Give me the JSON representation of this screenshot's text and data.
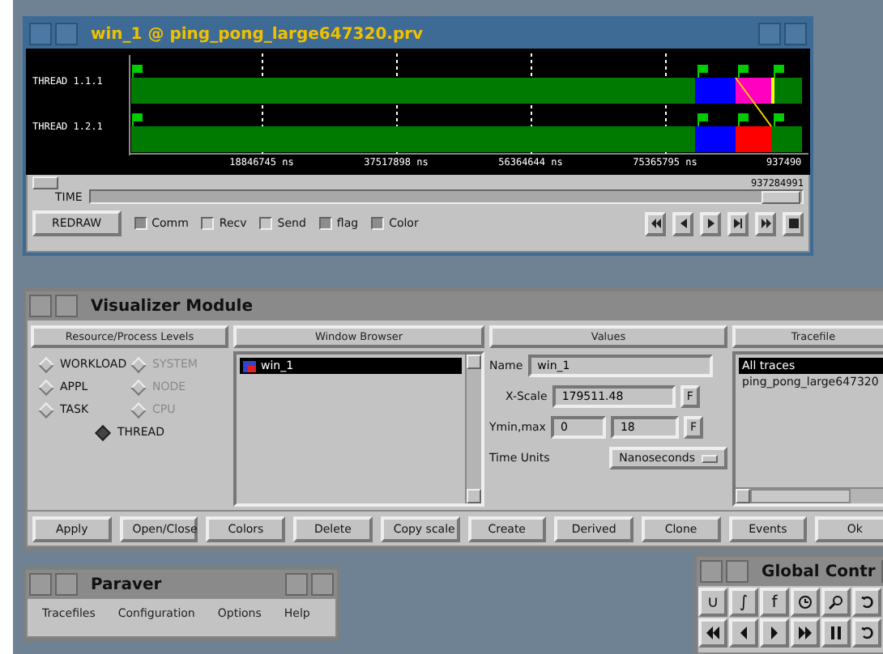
{
  "timeline_window": {
    "title": "win_1 @ ping_pong_large647320.prv",
    "threads": [
      "THREAD 1.1.1",
      "THREAD 1.2.1"
    ],
    "axis_labels": [
      "18846745 ns",
      "37517898 ns",
      "56364644 ns",
      "75365795 ns",
      "937490"
    ],
    "end_label": "937284991",
    "scroll_label": "TIME",
    "redraw": "REDRAW",
    "options": [
      {
        "label": "Comm",
        "checked": true
      },
      {
        "label": "Recv",
        "checked": false
      },
      {
        "label": "Send",
        "checked": false
      },
      {
        "label": "flag",
        "checked": true
      },
      {
        "label": "Color",
        "checked": true
      }
    ]
  },
  "visualizer": {
    "title": "Visualizer Module",
    "levels_header": "Resource/Process Levels",
    "levels": [
      {
        "label": "WORKLOAD",
        "disabled": false,
        "selected": false
      },
      {
        "label": "SYSTEM",
        "disabled": true,
        "selected": false
      },
      {
        "label": "APPL",
        "disabled": false,
        "selected": false
      },
      {
        "label": "NODE",
        "disabled": true,
        "selected": false
      },
      {
        "label": "TASK",
        "disabled": false,
        "selected": false
      },
      {
        "label": "CPU",
        "disabled": true,
        "selected": false
      },
      {
        "label": "THREAD",
        "disabled": false,
        "selected": true
      }
    ],
    "browser_header": "Window Browser",
    "windows": [
      {
        "label": "win_1",
        "selected": true
      }
    ],
    "values_header": "Values",
    "name_label": "Name",
    "name_value": "win_1",
    "xscale_label": "X-Scale",
    "xscale_value": "179511.48",
    "xscale_button": "F",
    "yminmax_label": "Ymin,max",
    "ymin": "0",
    "ymax": "18",
    "ymax_button": "F",
    "time_units_label": "Time Units",
    "time_units_value": "Nanoseconds",
    "tracefile_header": "Tracefile",
    "tracefiles": [
      {
        "label": "All traces",
        "selected": true
      },
      {
        "label": "ping_pong_large647320",
        "selected": false
      }
    ],
    "buttons": [
      "Apply",
      "Open/Close",
      "Colors",
      "Delete",
      "Copy scale",
      "Create",
      "Derived",
      "Clone",
      "Events",
      "Ok"
    ]
  },
  "paraver": {
    "title": "Paraver",
    "menu": [
      "Tracefiles",
      "Configuration",
      "Options",
      "Help"
    ]
  },
  "global_control": {
    "title": "Global Contr",
    "row_1": [
      {
        "kind": "text",
        "label": "∪"
      },
      {
        "kind": "text",
        "label": "∫"
      },
      {
        "kind": "text",
        "label": "f"
      },
      {
        "kind": "clock"
      },
      {
        "kind": "zoom"
      },
      {
        "kind": "undo"
      }
    ],
    "row_2": [
      {
        "kind": "rewind"
      },
      {
        "kind": "back"
      },
      {
        "kind": "play"
      },
      {
        "kind": "forward"
      },
      {
        "kind": "pause"
      },
      {
        "kind": "undo"
      }
    ]
  }
}
